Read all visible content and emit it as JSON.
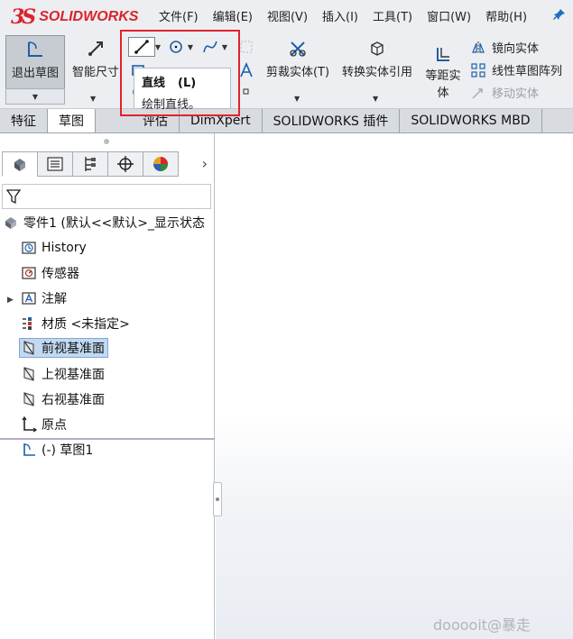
{
  "app": {
    "logo_ds": "3S",
    "logo_text": "SOLIDWORKS"
  },
  "menu": [
    "文件(F)",
    "编辑(E)",
    "视图(V)",
    "插入(I)",
    "工具(T)",
    "窗口(W)",
    "帮助(H)"
  ],
  "toolbar": {
    "exit_sketch": "退出草图",
    "smart_dimension": "智能尺寸",
    "trim_entities": "剪裁实体(T)",
    "convert_entities": "转换实体引用",
    "offset_entities_l1": "等距实",
    "offset_entities_l2": "体",
    "mirror_entities": "镜向实体",
    "linear_pattern": "线性草图阵列",
    "move_entities": "移动实体"
  },
  "tooltip": {
    "title": "直线",
    "shortcut": "(L)",
    "description": "绘制直线。"
  },
  "tabs": [
    "特征",
    "草图",
    "评估",
    "DimXpert",
    "SOLIDWORKS 插件",
    "SOLIDWORKS MBD"
  ],
  "tree": {
    "root": "零件1  (默认<<默认>_显示状态",
    "items": [
      {
        "label": "History"
      },
      {
        "label": "传感器"
      },
      {
        "label": "注解"
      },
      {
        "label": "材质 <未指定>"
      },
      {
        "label": "前视基准面"
      },
      {
        "label": "上视基准面"
      },
      {
        "label": "右视基准面"
      },
      {
        "label": "原点"
      },
      {
        "label": "(-) 草图1"
      }
    ]
  },
  "watermark": "dooooit@暴走",
  "colors": {
    "brand_red": "#d9242b",
    "highlight_border": "#e2232a",
    "selection": "#c3d9f1"
  }
}
